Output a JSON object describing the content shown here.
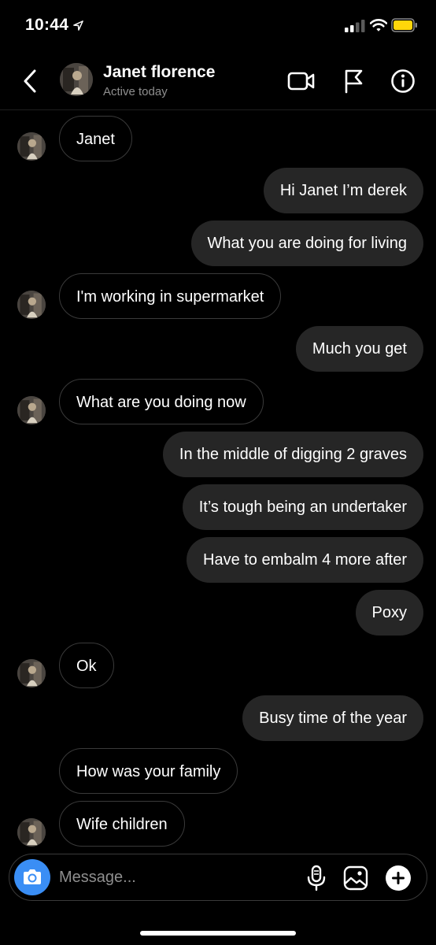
{
  "status_bar": {
    "time": "10:44"
  },
  "header": {
    "contact_name": "Janet florence",
    "contact_status": "Active today"
  },
  "messages": [
    {
      "dir": "in",
      "text": "Janet",
      "avatar": true
    },
    {
      "dir": "out",
      "text": "Hi Janet I’m derek"
    },
    {
      "dir": "out",
      "text": "What you are doing for living"
    },
    {
      "dir": "in",
      "text": "I'm working in supermarket",
      "avatar": true
    },
    {
      "dir": "out",
      "text": "Much you get"
    },
    {
      "dir": "in",
      "text": "What are you doing now",
      "avatar": true
    },
    {
      "dir": "out",
      "text": "In the middle of digging 2 graves"
    },
    {
      "dir": "out",
      "text": "It’s tough being an undertaker"
    },
    {
      "dir": "out",
      "text": "Have to embalm 4 more after"
    },
    {
      "dir": "out",
      "text": "Poxy"
    },
    {
      "dir": "in",
      "text": "Ok",
      "avatar": true
    },
    {
      "dir": "out",
      "text": "Busy time of the year"
    },
    {
      "dir": "in",
      "text": "How was your family",
      "avatar": false
    },
    {
      "dir": "in",
      "text": "Wife children",
      "avatar": true
    }
  ],
  "composer": {
    "placeholder": "Message..."
  },
  "colors": {
    "accent": "#3a8ef5",
    "outgoing_bubble": "#262626",
    "incoming_border": "#3a3a3a",
    "muted_text": "#8e8e8e"
  }
}
